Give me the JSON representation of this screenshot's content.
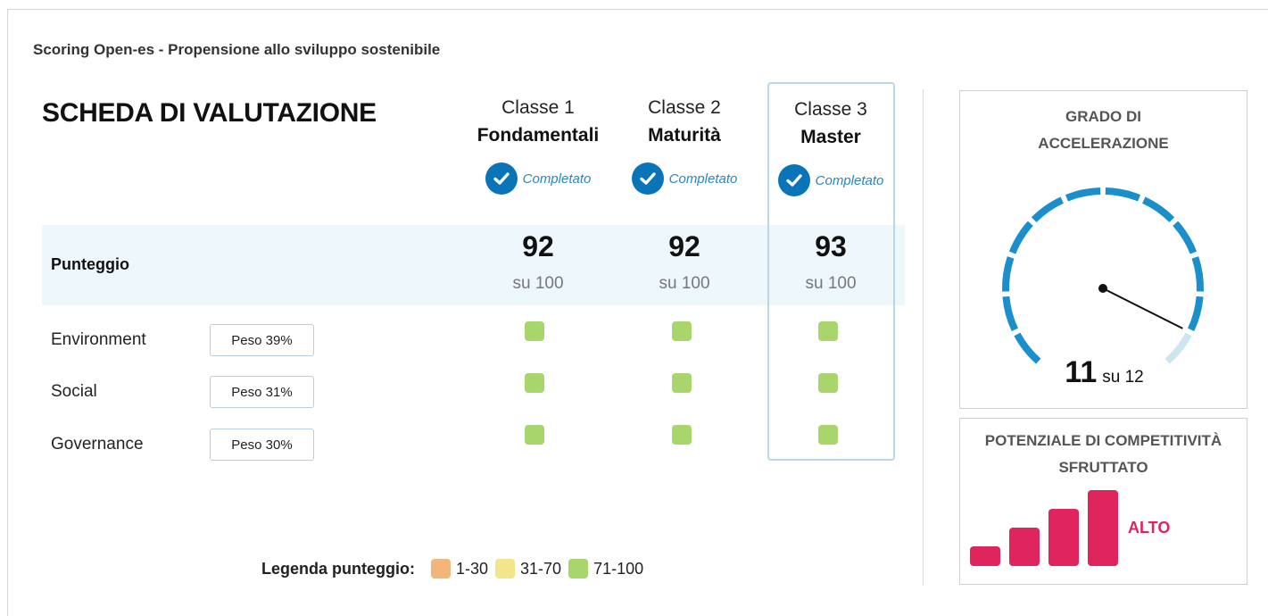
{
  "header": {
    "subtitle": "Scoring Open-es - Propensione allo sviluppo sostenibile"
  },
  "scheda": {
    "title": "SCHEDA DI VALUTAZIONE",
    "score_label": "Punteggio",
    "classes": [
      {
        "name": "Classe 1",
        "sub": "Fondamentali",
        "status": "Completato",
        "score": "92",
        "of": "su 100"
      },
      {
        "name": "Classe 2",
        "sub": "Maturità",
        "status": "Completato",
        "score": "92",
        "of": "su 100"
      },
      {
        "name": "Classe 3",
        "sub": "Master",
        "status": "Completato",
        "score": "93",
        "of": "su 100"
      }
    ],
    "rows": [
      {
        "label": "Environment",
        "weight": "Peso 39%"
      },
      {
        "label": "Social",
        "weight": "Peso 31%"
      },
      {
        "label": "Governance",
        "weight": "Peso 30%"
      }
    ]
  },
  "legend": {
    "title": "Legenda punteggio:",
    "items": [
      {
        "label": "1-30",
        "color": "#f2b57a"
      },
      {
        "label": "31-70",
        "color": "#f2e58a"
      },
      {
        "label": "71-100",
        "color": "#a8d56c"
      }
    ]
  },
  "acceleration": {
    "title_line1": "GRADO DI",
    "title_line2": "ACCELERAZIONE",
    "value": "11",
    "of": "su 12",
    "max": 12,
    "color_active": "#1a8fcc",
    "color_inactive": "#cde4f1"
  },
  "competitivity": {
    "title_line1": "POTENZIALE DI COMPETITIVITÀ",
    "title_line2": "SFRUTTATO",
    "level": "ALTO",
    "bars_total": 4,
    "bars_active": 4,
    "color": "#e0245e"
  },
  "colors": {
    "accent": "#0a74b8",
    "score_green": "#a8d56c",
    "band": "#eef7fc"
  }
}
